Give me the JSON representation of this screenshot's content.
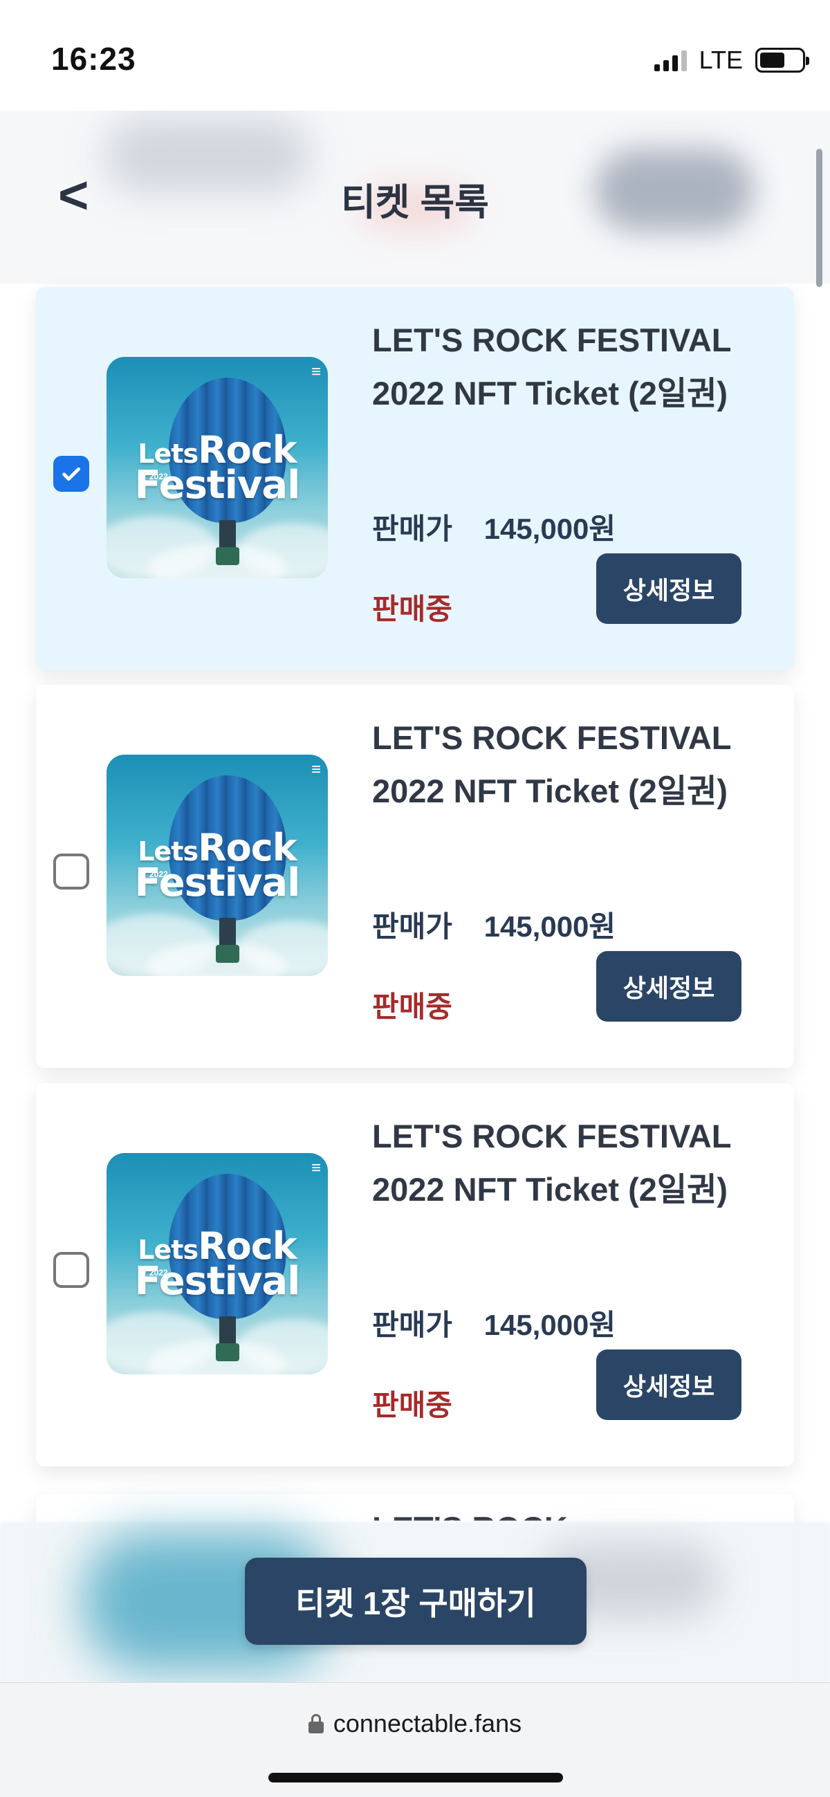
{
  "status_bar": {
    "time": "16:23",
    "network": "LTE",
    "battery_level": 0.6
  },
  "header": {
    "back_label": "<",
    "title": "티켓 목록"
  },
  "tickets": [
    {
      "name": "LET'S ROCK FESTIVAL 2022 NFT Ticket (2일권)",
      "price_label": "판매가",
      "price": "145,000원",
      "status": "판매중",
      "detail_label": "상세정보",
      "selected": true,
      "image": {
        "line1_small": "Lets",
        "line1": "Rock",
        "year": "2022",
        "line2": "Festival",
        "mark": "≡"
      }
    },
    {
      "name": "LET'S ROCK FESTIVAL 2022 NFT Ticket (2일권)",
      "price_label": "판매가",
      "price": "145,000원",
      "status": "판매중",
      "detail_label": "상세정보",
      "selected": false,
      "image": {
        "line1_small": "Lets",
        "line1": "Rock",
        "year": "2022",
        "line2": "Festival",
        "mark": "≡"
      }
    },
    {
      "name": "LET'S ROCK FESTIVAL 2022 NFT Ticket (2일권)",
      "price_label": "판매가",
      "price": "145,000원",
      "status": "판매중",
      "detail_label": "상세정보",
      "selected": false,
      "image": {
        "line1_small": "Lets",
        "line1": "Rock",
        "year": "2022",
        "line2": "Festival",
        "mark": "≡"
      }
    }
  ],
  "partial_ticket_title": "LET'S ROCK",
  "buy_button_label": "티켓 1장 구매하기",
  "browser": {
    "url": "connectable.fans"
  },
  "colors": {
    "accent_navy": "#2b4566",
    "selected_card_bg": "#e7f5fe",
    "status_red": "#a52b2b",
    "checkbox_blue": "#1a73e8"
  },
  "icons": [
    "signal-icon",
    "battery-icon",
    "back-arrow-icon",
    "checkbox-checked-icon",
    "checkbox-empty-icon",
    "lock-icon"
  ]
}
